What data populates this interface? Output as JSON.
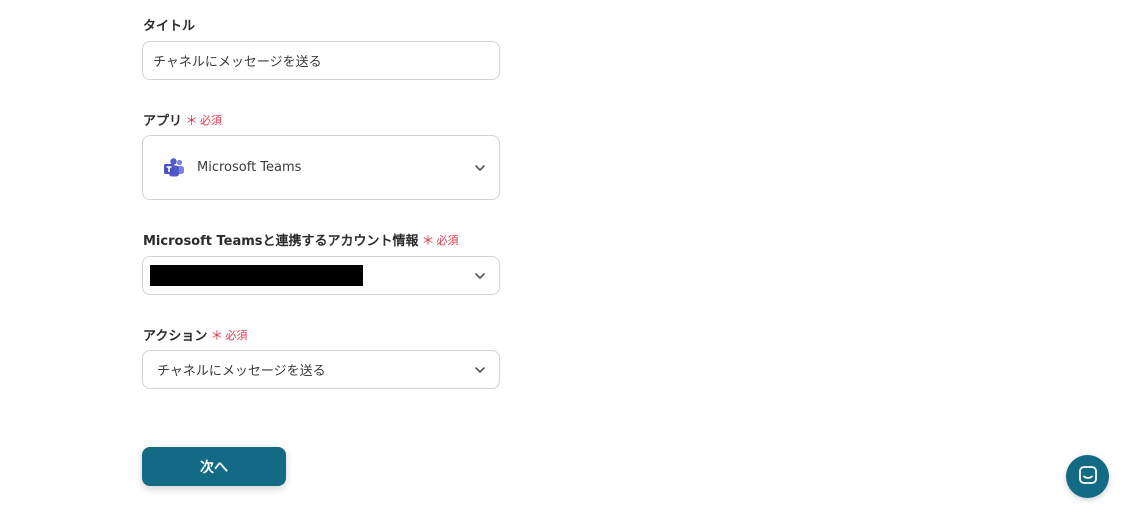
{
  "title_field": {
    "label": "タイトル",
    "value": "チャネルにメッセージを送る"
  },
  "app_field": {
    "label": "アプリ",
    "required_mark": "＊",
    "required_text": "必須",
    "value": "Microsoft Teams",
    "icon": "microsoft-teams-icon"
  },
  "account_field": {
    "label": "Microsoft Teamsと連携するアカウント情報",
    "required_mark": "＊",
    "required_text": "必須"
  },
  "action_field": {
    "label": "アクション",
    "required_mark": "＊",
    "required_text": "必須",
    "value": "チャネルにメッセージを送る"
  },
  "next_button": {
    "label": "次へ"
  },
  "colors": {
    "primary": "#136a85",
    "required": "#e0394f",
    "teams_purple": "#5059c9"
  }
}
